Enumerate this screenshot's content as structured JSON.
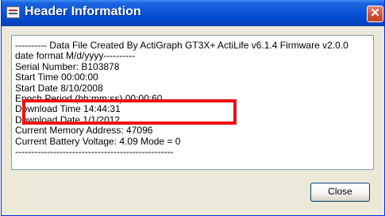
{
  "window": {
    "title": "Header Information",
    "close_glyph": "✕"
  },
  "header_text": {
    "lines": [
      "---------- Data File Created By ActiGraph GT3X+ ActiLife v6.1.4 Firmware v2.0.0",
      "date format M/d/yyyy----------",
      "Serial Number: B103878",
      "Start Time 00:00:00",
      "Start Date 8/10/2008",
      "Epoch Period (hh:mm:ss) 00:00:60",
      "Download Time 14:44:31",
      "Download Date 1/1/2012",
      "Current Memory Address: 47096",
      "Current Battery Voltage: 4.09     Mode = 0",
      "--------------------------------------------------"
    ]
  },
  "buttons": {
    "close_label": "Close"
  },
  "colors": {
    "highlight": "#ee1111",
    "titlebar": "#0a55d8"
  }
}
